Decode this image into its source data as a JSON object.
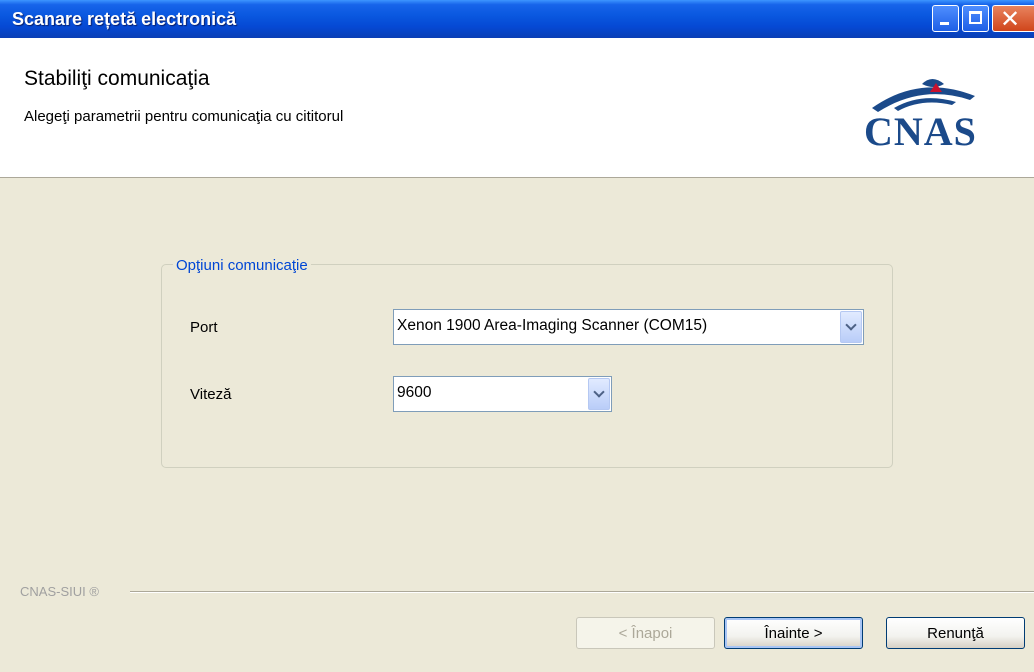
{
  "window": {
    "title": "Scanare rețetă electronică"
  },
  "header": {
    "title": "Stabiliţi comunicaţia",
    "subtitle": "Alegeţi parametrii pentru comunicaţia cu cititorul",
    "logo_text": "CNAS"
  },
  "group": {
    "legend": "Opţiuni comunicaţie",
    "port_label": "Port",
    "port_value": "Xenon 1900 Area-Imaging Scanner (COM15)",
    "speed_label": "Viteză",
    "speed_value": "9600"
  },
  "footer": {
    "label": "CNAS-SIUI ®",
    "back_label": "< Înapoi",
    "next_label": "Înainte >",
    "cancel_label": "Renunţă"
  },
  "colors": {
    "titlebar": "#0a58e0",
    "legend": "#0046d5",
    "logo": "#1b4a8a"
  }
}
